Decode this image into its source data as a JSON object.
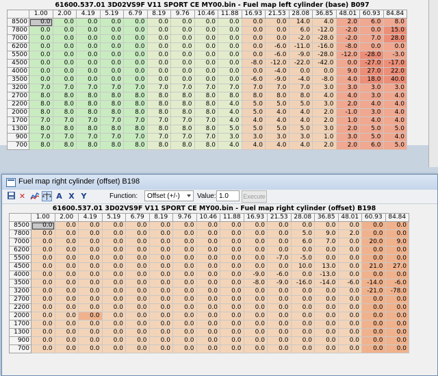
{
  "columns": [
    "1.00",
    "2.00",
    "4.19",
    "5.19",
    "6.79",
    "8.19",
    "9.76",
    "10.46",
    "11.88",
    "16.93",
    "21.53",
    "28.08",
    "36.85",
    "48.01",
    "60.93",
    "84.84"
  ],
  "rows_rpm": [
    "8500",
    "7800",
    "7000",
    "6200",
    "5500",
    "4500",
    "4000",
    "3500",
    "3200",
    "2700",
    "2200",
    "2000",
    "1700",
    "1300",
    "900",
    "700"
  ],
  "base_map": {
    "title": "61600.537.01  3D02VS9F  V11  SPORT  CE  MY00.bin - Fuel map left cylinder  (base) B097",
    "values": [
      [
        "0.0",
        "0.0",
        "0.0",
        "0.0",
        "0.0",
        "0.0",
        "0.0",
        "0.0",
        "0.0",
        "0.0",
        "0.0",
        "14.0",
        "4.0",
        "2.0",
        "6.0",
        "8.0"
      ],
      [
        "0.0",
        "0.0",
        "0.0",
        "0.0",
        "0.0",
        "0.0",
        "0.0",
        "0.0",
        "0.0",
        "0.0",
        "0.0",
        "6.0",
        "-12.0",
        "-2.0",
        "0.0",
        "15.0"
      ],
      [
        "0.0",
        "0.0",
        "0.0",
        "0.0",
        "0.0",
        "0.0",
        "0.0",
        "0.0",
        "0.0",
        "0.0",
        "0.0",
        "-2.0",
        "-28.0",
        "-2.0",
        "7.0",
        "28.0"
      ],
      [
        "0.0",
        "0.0",
        "0.0",
        "0.0",
        "0.0",
        "0.0",
        "0.0",
        "0.0",
        "0.0",
        "0.0",
        "-6.0",
        "-11.0",
        "-16.0",
        "-8.0",
        "0.0",
        "0.0"
      ],
      [
        "0.0",
        "0.0",
        "0.0",
        "0.0",
        "0.0",
        "0.0",
        "0.0",
        "0.0",
        "0.0",
        "0.0",
        "-6.0",
        "-9.0",
        "-28.0",
        "-12.0",
        "-28.0",
        "-3.0"
      ],
      [
        "0.0",
        "0.0",
        "0.0",
        "0.0",
        "0.0",
        "0.0",
        "0.0",
        "0.0",
        "0.0",
        "-8.0",
        "-12.0",
        "-22.0",
        "-42.0",
        "0.0",
        "-27.0",
        "-17.0"
      ],
      [
        "0.0",
        "0.0",
        "0.0",
        "0.0",
        "0.0",
        "0.0",
        "0.0",
        "0.0",
        "0.0",
        "0.0",
        "-4.0",
        "0.0",
        "0.0",
        "9.0",
        "27.0",
        "22.0"
      ],
      [
        "0.0",
        "0.0",
        "0.0",
        "0.0",
        "0.0",
        "0.0",
        "0.0",
        "0.0",
        "0.0",
        "-6.0",
        "-9.0",
        "-4.0",
        "-8.0",
        "4.0",
        "18.0",
        "40.0"
      ],
      [
        "7.0",
        "7.0",
        "7.0",
        "7.0",
        "7.0",
        "7.0",
        "7.0",
        "7.0",
        "7.0",
        "7.0",
        "7.0",
        "7.0",
        "3.0",
        "3.0",
        "3.0",
        "3.0"
      ],
      [
        "8.0",
        "8.0",
        "8.0",
        "8.0",
        "8.0",
        "8.0",
        "8.0",
        "8.0",
        "8.0",
        "8.0",
        "8.0",
        "8.0",
        "4.0",
        "4.0",
        "3.0",
        "4.0"
      ],
      [
        "8.0",
        "8.0",
        "8.0",
        "8.0",
        "8.0",
        "8.0",
        "8.0",
        "8.0",
        "4.0",
        "5.0",
        "5.0",
        "5.0",
        "3.0",
        "2.0",
        "4.0",
        "4.0"
      ],
      [
        "8.0",
        "8.0",
        "8.0",
        "8.0",
        "8.0",
        "8.0",
        "8.0",
        "8.0",
        "4.0",
        "5.0",
        "4.0",
        "4.0",
        "2.0",
        "-1.0",
        "3.0",
        "4.0"
      ],
      [
        "7.0",
        "7.0",
        "7.0",
        "7.0",
        "7.0",
        "7.0",
        "7.0",
        "7.0",
        "4.0",
        "4.0",
        "4.0",
        "4.0",
        "2.0",
        "1.0",
        "4.0",
        "4.0"
      ],
      [
        "8.0",
        "8.0",
        "8.0",
        "8.0",
        "8.0",
        "8.0",
        "8.0",
        "8.0",
        "5.0",
        "5.0",
        "5.0",
        "5.0",
        "3.0",
        "2.0",
        "5.0",
        "5.0"
      ],
      [
        "7.0",
        "7.0",
        "7.0",
        "7.0",
        "7.0",
        "7.0",
        "7.0",
        "7.0",
        "3.0",
        "3.0",
        "3.0",
        "3.0",
        "1.0",
        "3.0",
        "5.0",
        "4.0"
      ],
      [
        "8.0",
        "8.0",
        "8.0",
        "8.0",
        "8.0",
        "8.0",
        "8.0",
        "8.0",
        "4.0",
        "4.0",
        "4.0",
        "4.0",
        "2.0",
        "2.0",
        "6.0",
        "5.0"
      ]
    ]
  },
  "window": {
    "title": "Fuel map right cylinder (offset) B198",
    "toolbar": {
      "icons": [
        "save-icon",
        "delete-icon",
        "graph-icon",
        "compare-icon",
        "axis-a-icon",
        "axis-x-icon",
        "axis-y-icon"
      ],
      "function_label": "Function:",
      "function_value": "Offset (+/-)",
      "value_label": "Value:",
      "value_input": "1.0",
      "execute_label": "Execute"
    },
    "grid_title": "61600.537.01  3D02VS9F  V11  SPORT  CE  MY00.bin - Fuel map right cylinder (offset) B198",
    "values": [
      [
        "0.0",
        "0.0",
        "0.0",
        "0.0",
        "0.0",
        "0.0",
        "0.0",
        "0.0",
        "0.0",
        "0.0",
        "0.0",
        "0.0",
        "0.0",
        "0.0",
        "0.0",
        "0.0"
      ],
      [
        "0.0",
        "0.0",
        "0.0",
        "0.0",
        "0.0",
        "0.0",
        "0.0",
        "0.0",
        "0.0",
        "0.0",
        "0.0",
        "5.0",
        "9.0",
        "2.0",
        "0.0",
        "0.0"
      ],
      [
        "0.0",
        "0.0",
        "0.0",
        "0.0",
        "0.0",
        "0.0",
        "0.0",
        "0.0",
        "0.0",
        "0.0",
        "0.0",
        "6.0",
        "7.0",
        "0.0",
        "20.0",
        "9.0"
      ],
      [
        "0.0",
        "0.0",
        "0.0",
        "0.0",
        "0.0",
        "0.0",
        "0.0",
        "0.0",
        "0.0",
        "0.0",
        "0.0",
        "0.0",
        "0.0",
        "0.0",
        "0.0",
        "0.0"
      ],
      [
        "0.0",
        "0.0",
        "0.0",
        "0.0",
        "0.0",
        "0.0",
        "0.0",
        "0.0",
        "0.0",
        "0.0",
        "-7.0",
        "-5.0",
        "0.0",
        "0.0",
        "0.0",
        "0.0"
      ],
      [
        "0.0",
        "0.0",
        "0.0",
        "0.0",
        "0.0",
        "0.0",
        "0.0",
        "0.0",
        "0.0",
        "0.0",
        "0.0",
        "10.0",
        "13.0",
        "0.0",
        "21.0",
        "27.0"
      ],
      [
        "0.0",
        "0.0",
        "0.0",
        "0.0",
        "0.0",
        "0.0",
        "0.0",
        "0.0",
        "0.0",
        "-9.0",
        "-6.0",
        "0.0",
        "-13.0",
        "0.0",
        "0.0",
        "0.0"
      ],
      [
        "0.0",
        "0.0",
        "0.0",
        "0.0",
        "0.0",
        "0.0",
        "0.0",
        "0.0",
        "0.0",
        "-8.0",
        "-9.0",
        "-16.0",
        "-14.0",
        "-6.0",
        "-14.0",
        "-6.0"
      ],
      [
        "0.0",
        "0.0",
        "0.0",
        "0.0",
        "0.0",
        "0.0",
        "0.0",
        "0.0",
        "0.0",
        "0.0",
        "0.0",
        "0.0",
        "0.0",
        "0.0",
        "-21.0",
        "-78.0"
      ],
      [
        "0.0",
        "0.0",
        "0.0",
        "0.0",
        "0.0",
        "0.0",
        "0.0",
        "0.0",
        "0.0",
        "0.0",
        "0.0",
        "0.0",
        "0.0",
        "0.0",
        "0.0",
        "0.0"
      ],
      [
        "0.0",
        "0.0",
        "0.0",
        "0.0",
        "0.0",
        "0.0",
        "0.0",
        "0.0",
        "0.0",
        "0.0",
        "0.0",
        "0.0",
        "0.0",
        "0.0",
        "0.0",
        "0.0"
      ],
      [
        "0.0",
        "0.0",
        "0.0",
        "0.0",
        "0.0",
        "0.0",
        "0.0",
        "0.0",
        "0.0",
        "0.0",
        "0.0",
        "0.0",
        "0.0",
        "0.0",
        "0.0",
        "0.0"
      ],
      [
        "0.0",
        "0.0",
        "0.0",
        "0.0",
        "0.0",
        "0.0",
        "0.0",
        "0.0",
        "0.0",
        "0.0",
        "0.0",
        "0.0",
        "0.0",
        "0.0",
        "0.0",
        "0.0"
      ],
      [
        "0.0",
        "0.0",
        "0.0",
        "0.0",
        "0.0",
        "0.0",
        "0.0",
        "0.0",
        "0.0",
        "0.0",
        "0.0",
        "0.0",
        "0.0",
        "0.0",
        "0.0",
        "0.0"
      ],
      [
        "0.0",
        "0.0",
        "0.0",
        "0.0",
        "0.0",
        "0.0",
        "0.0",
        "0.0",
        "0.0",
        "0.0",
        "0.0",
        "0.0",
        "0.0",
        "0.0",
        "0.0",
        "0.0"
      ],
      [
        "0.0",
        "0.0",
        "0.0",
        "0.0",
        "0.0",
        "0.0",
        "0.0",
        "0.0",
        "0.0",
        "0.0",
        "0.0",
        "0.0",
        "0.0",
        "0.0",
        "0.0",
        "0.0"
      ]
    ]
  },
  "colors": {
    "base_green": "#c8ecc0",
    "base_light": "#e2eccc",
    "base_peach": "#f1d2b6",
    "base_salmon": "#f0a890",
    "base_red": "#ec8e78",
    "offset_peach": "#f3d4b8",
    "offset_salmon": "#f0b28c",
    "header_grey": "#f4f4f4",
    "selection": "#c8c8c8"
  }
}
